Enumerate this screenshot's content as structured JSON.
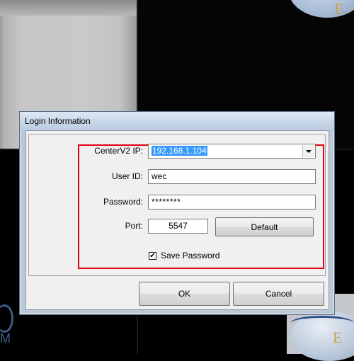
{
  "dialog": {
    "title": "Login Information",
    "fields": {
      "centerv2_ip": {
        "label": "CenterV2 IP:",
        "value": "192.168.1.104"
      },
      "user_id": {
        "label": "User ID:",
        "value": "wec"
      },
      "password": {
        "label": "Password:",
        "value": "********"
      },
      "port": {
        "label": "Port:",
        "value": "5547"
      }
    },
    "default_label": "Default",
    "save_password": {
      "label": "Save Password",
      "checked": true,
      "mark": "✔"
    },
    "ok_label": "OK",
    "cancel_label": "Cancel"
  },
  "background": {
    "logo_letter": "E",
    "logo_letter_bl": "M"
  },
  "colors": {
    "highlight_border": "#e3000f",
    "selection": "#3399ff"
  }
}
